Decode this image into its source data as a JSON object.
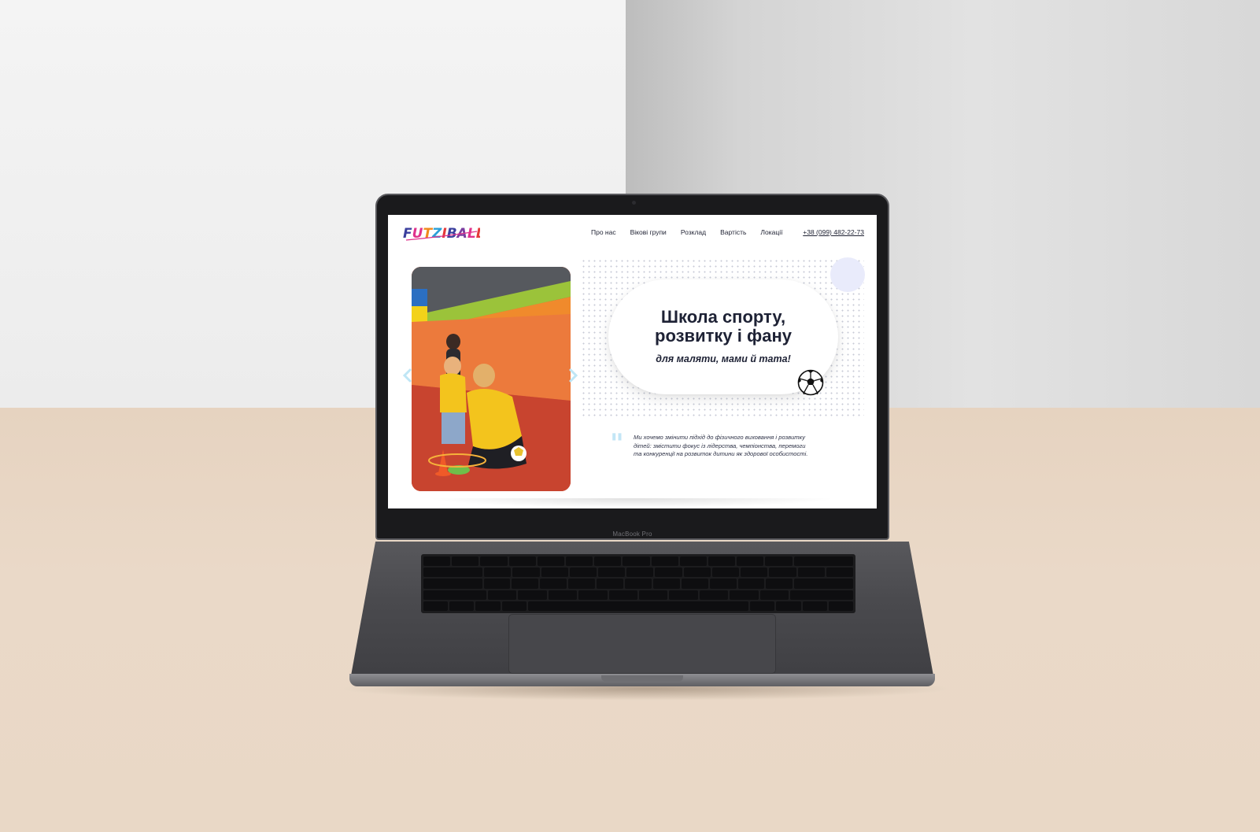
{
  "site": {
    "logo_text": "FUTZIBALL",
    "nav": {
      "items": [
        {
          "label": "Про нас"
        },
        {
          "label": "Вікові групи"
        },
        {
          "label": "Розклад"
        },
        {
          "label": "Вартість"
        },
        {
          "label": "Локації"
        }
      ],
      "phone": "+38 (099) 482-22-73"
    },
    "hero": {
      "title_line1": "Школа спорту,",
      "title_line2": "розвитку і фану",
      "subtitle": "для маляти, мами й тата!",
      "quote": "Ми хочемо змінити підхід до фізичного виховання і розвитку дітей: змістити фокус із лідерства, чемпіонства, перемоги та конкуренції на розвиток дитини як здорової особистості."
    }
  },
  "device": {
    "brand_label": "MacBook Pro"
  },
  "colors": {
    "text_dark": "#1e2235",
    "accent_blue_light": "#e9ebfb",
    "quote_blue": "#c3e6f6",
    "arrow_blue": "#bfe6f5"
  },
  "icons": {
    "prev_arrow": "chevron-left-icon",
    "next_arrow": "chevron-right-icon",
    "ball": "soccer-ball-icon",
    "quote": "quote-icon"
  }
}
